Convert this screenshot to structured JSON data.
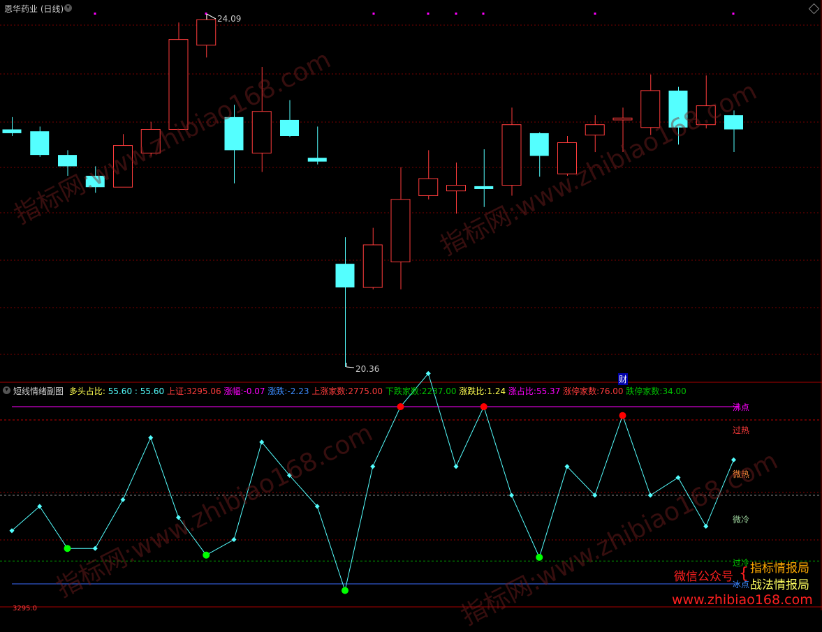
{
  "main": {
    "title": "恩华药业 (日线)",
    "high_label": "24.09",
    "low_label": "20.36",
    "cai_marker": "财"
  },
  "sub": {
    "title": "短线情绪副图",
    "duotou_label": "多头占比:",
    "duotou_v1": "55.60",
    "duotou_v2": ": 55.60",
    "sz_label": "上证:",
    "sz_value": "3295.06",
    "zhangfu_label": "涨幅:",
    "zhangfu_value": "-0.07",
    "zhangdie_label": "涨跌:",
    "zhangdie_value": "-2.23",
    "up_label": "上涨家数:",
    "up_value": "2775.00",
    "down_label": "下跌家数:",
    "down_value": "2237.00",
    "ratio_label": "涨跌比:",
    "ratio_value": "1.24",
    "upratio_label": "涨占比:",
    "upratio_value": "55.37",
    "limitup_label": "涨停家数:",
    "limitup_value": "76.00",
    "limitdown_label": "跌停家数:",
    "limitdown_value": "34.00",
    "levels": {
      "boil": "沸点",
      "overheat": "过热",
      "warm": "微热",
      "cool": "微冷",
      "overcold": "过冷",
      "ice": "冰点"
    },
    "bottom_label": "3295.0"
  },
  "watermark": {
    "site": "www.zhibiao168.com",
    "cn": "指标网:",
    "cn2": "指标网",
    "wechat": "微信公众号",
    "brand1": "指标情报局",
    "brand2": "战法情报局",
    "footer": "www.zhibiao168.com"
  },
  "colors": {
    "up": "#ff3c3c",
    "down": "#54ffff",
    "line": "#54ffff",
    "boil": "#ff00ff",
    "hot_dot": "#ff0000",
    "cold_dot": "#00ff00"
  },
  "chart_data": {
    "type": "candlestick",
    "candles": [
      {
        "o": 22.87,
        "c": 22.83,
        "h": 23.0,
        "l": 22.8
      },
      {
        "o": 22.85,
        "c": 22.6,
        "h": 22.9,
        "l": 22.58
      },
      {
        "o": 22.6,
        "c": 22.48,
        "h": 22.65,
        "l": 22.38
      },
      {
        "o": 22.38,
        "c": 22.26,
        "h": 22.48,
        "l": 22.2
      },
      {
        "o": 22.26,
        "c": 22.7,
        "h": 22.82,
        "l": 22.26
      },
      {
        "o": 22.62,
        "c": 22.87,
        "h": 22.95,
        "l": 22.59
      },
      {
        "o": 22.87,
        "c": 23.82,
        "h": 24.0,
        "l": 22.87
      },
      {
        "o": 23.76,
        "c": 24.03,
        "h": 24.09,
        "l": 23.63
      },
      {
        "o": 23.0,
        "c": 22.65,
        "h": 23.13,
        "l": 22.3
      },
      {
        "o": 22.62,
        "c": 23.06,
        "h": 23.53,
        "l": 22.42
      },
      {
        "o": 22.97,
        "c": 22.8,
        "h": 23.18,
        "l": 22.79
      },
      {
        "o": 22.57,
        "c": 22.53,
        "h": 22.9,
        "l": 22.5
      },
      {
        "o": 21.45,
        "c": 21.2,
        "h": 21.73,
        "l": 20.36
      },
      {
        "o": 21.2,
        "c": 21.65,
        "h": 21.83,
        "l": 21.18
      },
      {
        "o": 21.47,
        "c": 22.13,
        "h": 22.47,
        "l": 21.18
      },
      {
        "o": 22.17,
        "c": 22.35,
        "h": 22.65,
        "l": 22.13
      },
      {
        "o": 22.22,
        "c": 22.28,
        "h": 22.52,
        "l": 21.98
      },
      {
        "o": 22.27,
        "c": 22.24,
        "h": 22.66,
        "l": 22.05
      },
      {
        "o": 22.28,
        "c": 22.92,
        "h": 23.1,
        "l": 22.17
      },
      {
        "o": 22.83,
        "c": 22.59,
        "h": 22.84,
        "l": 22.37
      },
      {
        "o": 22.4,
        "c": 22.73,
        "h": 22.8,
        "l": 22.38
      },
      {
        "o": 22.81,
        "c": 22.92,
        "h": 23.02,
        "l": 22.63
      },
      {
        "o": 22.97,
        "c": 22.99,
        "h": 23.1,
        "l": 22.63
      },
      {
        "o": 22.89,
        "c": 23.28,
        "h": 23.45,
        "l": 22.81
      },
      {
        "o": 23.28,
        "c": 22.89,
        "h": 23.32,
        "l": 22.71
      },
      {
        "o": 22.92,
        "c": 23.12,
        "h": 23.44,
        "l": 22.88
      },
      {
        "o": 23.02,
        "c": 22.87,
        "h": 23.07,
        "l": 22.63
      }
    ],
    "sentiment": [
      44,
      55,
      36,
      36,
      58,
      86,
      50,
      33,
      40,
      84,
      69,
      55,
      17,
      73,
      100,
      115,
      73,
      100,
      60,
      32,
      73,
      60,
      96,
      60,
      68,
      46,
      76
    ],
    "hot_points": [
      14,
      17,
      22
    ],
    "cold_points": [
      2,
      7,
      12,
      19
    ],
    "levels": {
      "boil": 100,
      "overheat": 94,
      "warm": 62,
      "cool": 42,
      "overcold": 30,
      "ice": 20
    }
  }
}
